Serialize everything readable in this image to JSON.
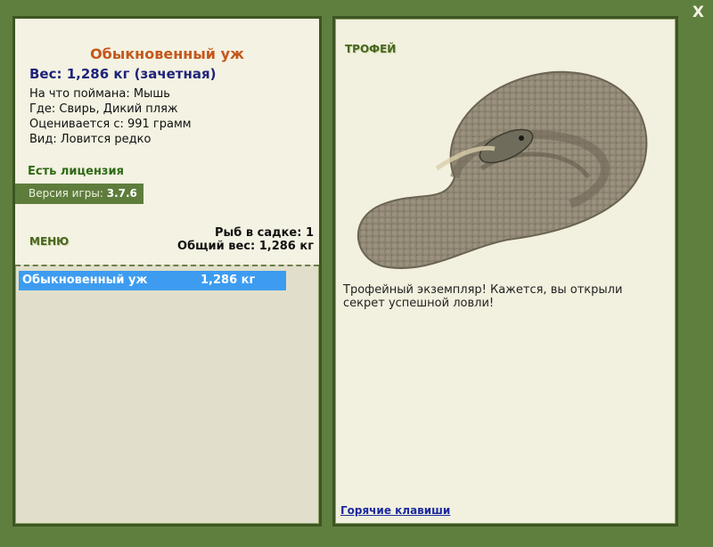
{
  "window": {
    "close_label": "X"
  },
  "fish": {
    "name": "Обыкновенный уж",
    "weight_line": "Вес: 1,286 кг (зачетная)",
    "caught_on": "На что поймана: Мышь",
    "location": "Где: Свирь, Дикий пляж",
    "valued_from": "Оценивается с: 991 грамм",
    "kind": "Вид: Ловится редко"
  },
  "license": "Есть лицензия",
  "version": {
    "label": "Версия игры:",
    "value": "3.7.6"
  },
  "menu_label": "МЕНЮ",
  "keepnet": {
    "count_line": "Рыб в садке: 1",
    "total_line": "Общий вес: 1,286 кг"
  },
  "catch_list": [
    {
      "name": "Обыкновенный уж",
      "weight": "1,286 кг"
    }
  ],
  "trophy": {
    "label": "ТРОФЕЙ",
    "description": "Трофейный экземпляр! Кажется, вы открыли секрет успешной ловли!"
  },
  "hotkeys_link": "Горячие клавиши"
}
